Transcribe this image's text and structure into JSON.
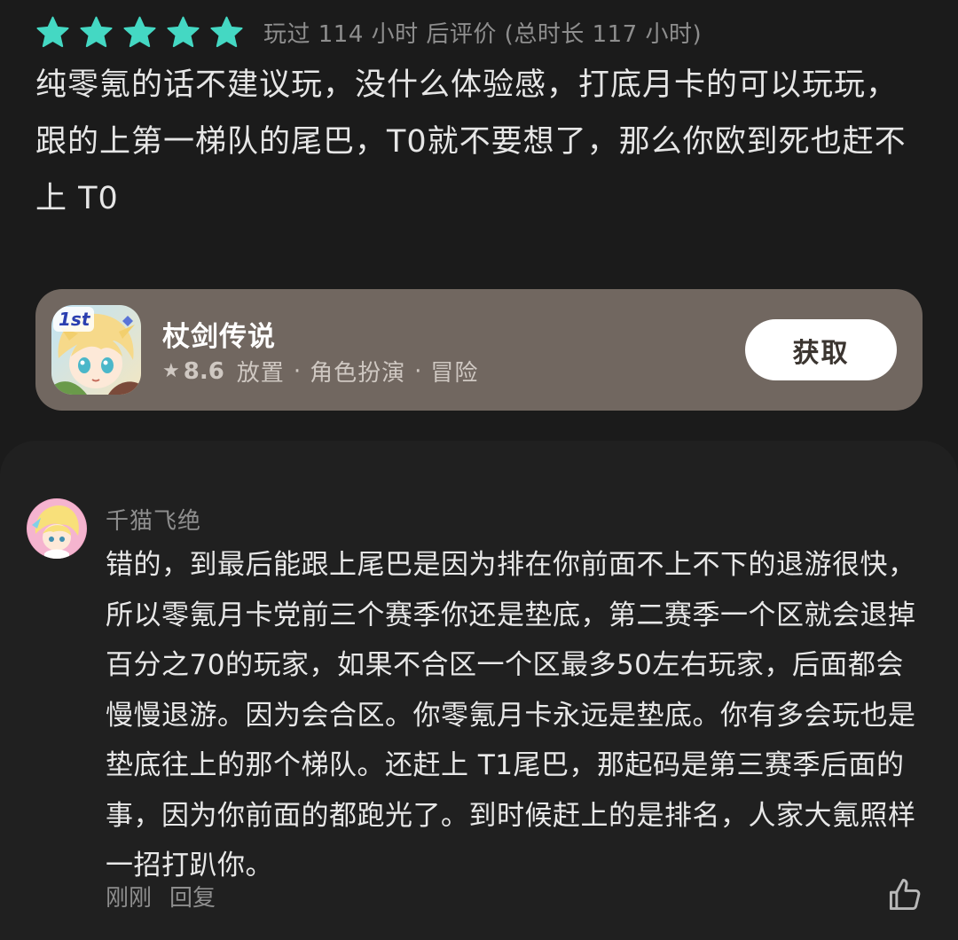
{
  "review": {
    "star_count": 5,
    "star_color": "#44d8c3",
    "play_info": "玩过 114 小时 后评价 (总时长 117 小时)",
    "body": "纯零氪的话不建议玩，没什么体验感，打底月卡的可以玩玩，跟的上第一梯队的尾巴，T0就不要想了，那么你欧到死也赶不上 T0"
  },
  "game_card": {
    "icon": "game-app-icon",
    "icon_badge": "1st",
    "title": "杖剑传说",
    "star_glyph": "★",
    "score": "8.6",
    "tags": [
      "放置",
      "角色扮演",
      "冒险"
    ],
    "separator": "·",
    "get_label": "获取",
    "card_color": "#716760"
  },
  "reply": {
    "avatar": "user-avatar",
    "author": "千猫飞绝",
    "text": "错的，到最后能跟上尾巴是因为排在你前面不上不下的退游很快，所以零氪月卡党前三个赛季你还是垫底，第二赛季一个区就会退掉百分之70的玩家，如果不合区一个区最多50左右玩家，后面都会慢慢退游。因为会合区。你零氪月卡永远是垫底。你有多会玩也是垫底往上的那个梯队。还赶上 T1尾巴，那起码是第三赛季后面的事，因为你前面的都跑光了。到时候赶上的是排名，人家大氪照样一招打趴你。",
    "time": "刚刚",
    "reply_label": "回复",
    "like_icon": "thumbs-up-icon"
  }
}
